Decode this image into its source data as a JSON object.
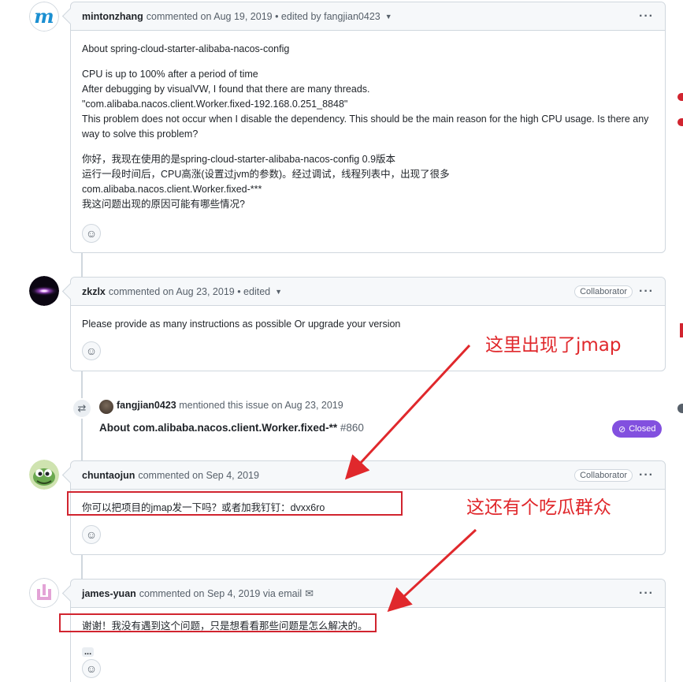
{
  "comments": [
    {
      "author": "mintonzhang",
      "meta": "commented on Aug 19, 2019 • edited by fangjian0423",
      "body": [
        "About spring-cloud-starter-alibaba-nacos-config",
        "CPU is up to 100% after a period of time\nAfter debugging by visualVW, I found that there are many threads.\n\"com.alibaba.nacos.client.Worker.fixed-192.168.0.251_8848\"\nThis problem does not occur when I disable the dependency. This should be the main reason for the high CPU usage. Is there any way to solve this problem?",
        "你好，我现在使用的是spring-cloud-starter-alibaba-nacos-config 0.9版本\n运行一段时间后，CPU高涨(设置过jvm的参数)。经过调试，线程列表中，出现了很多\ncom.alibaba.nacos.client.Worker.fixed-***\n我这问题出现的原因可能有哪些情况?"
      ]
    },
    {
      "author": "zkzlx",
      "meta": "commented on Aug 23, 2019 • edited",
      "badge": "Collaborator",
      "body": [
        "Please provide as many instructions as possible Or upgrade your version"
      ]
    },
    {
      "author": "chuntaojun",
      "meta": "commented on Sep 4, 2019",
      "badge": "Collaborator",
      "body": [
        "你可以把项目的jmap发一下吗？或者加我钉钉：dvxx6ro"
      ]
    },
    {
      "author": "james-yuan",
      "meta": "commented on Sep 4, 2019 via email",
      "body": [
        "谢谢！我没有遇到这个问题，只是想看看那些问题是怎么解决的。"
      ],
      "ellipsis": "..."
    }
  ],
  "event": {
    "author": "fangjian0423",
    "text": "mentioned this issue on Aug 23, 2019",
    "title": "About com.alibaba.nacos.client.Worker.fixed-**",
    "number": "#860",
    "status": "Closed"
  },
  "annotations": {
    "first": "这里出现了jmap",
    "second": "这还有个吃瓜群众"
  },
  "icons": {
    "reaction": "smiley-icon",
    "menu": "kebab-horizontal-icon",
    "cross_reference": "cross-reference-icon",
    "email": "mail-icon"
  },
  "colors": {
    "annotation_red": "#e0282c",
    "closed_purple": "#8250df",
    "border": "#d0d7de"
  }
}
